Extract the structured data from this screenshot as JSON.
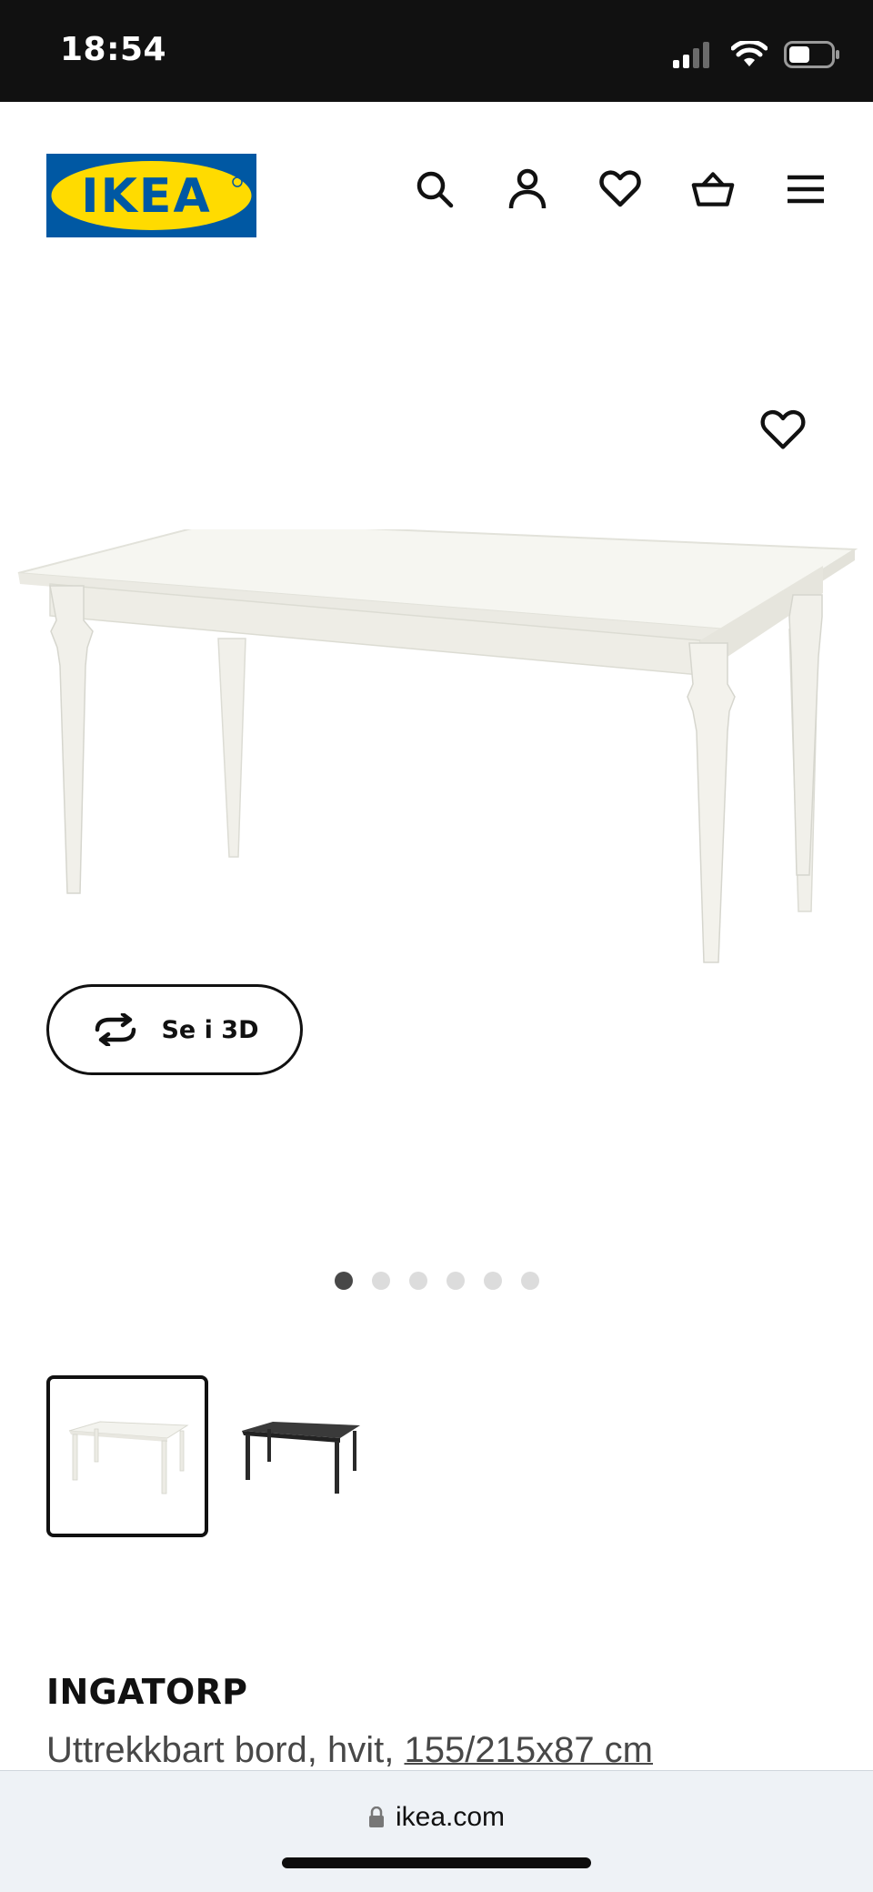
{
  "status_bar": {
    "time": "18:54",
    "icons": [
      "signal-icon",
      "wifi-icon",
      "battery-icon"
    ]
  },
  "header": {
    "logo_text": "IKEA",
    "icons": [
      "search-icon",
      "account-icon",
      "favorites-icon",
      "cart-icon",
      "menu-icon"
    ]
  },
  "gallery": {
    "view_3d_label": "Se i 3D",
    "slide_count": 6,
    "active_slide": 1,
    "thumbnails": [
      {
        "color": "white",
        "selected": true
      },
      {
        "color": "black",
        "selected": false
      }
    ]
  },
  "product": {
    "name": "INGATORP",
    "description_prefix": "Uttrekkbart bord, hvit, ",
    "dimensions": "155/215x87 cm"
  },
  "browser": {
    "url": "ikea.com"
  },
  "colors": {
    "ikea_blue": "#0058A3",
    "ikea_yellow": "#FFDB00",
    "status_bar_bg": "#111111"
  }
}
